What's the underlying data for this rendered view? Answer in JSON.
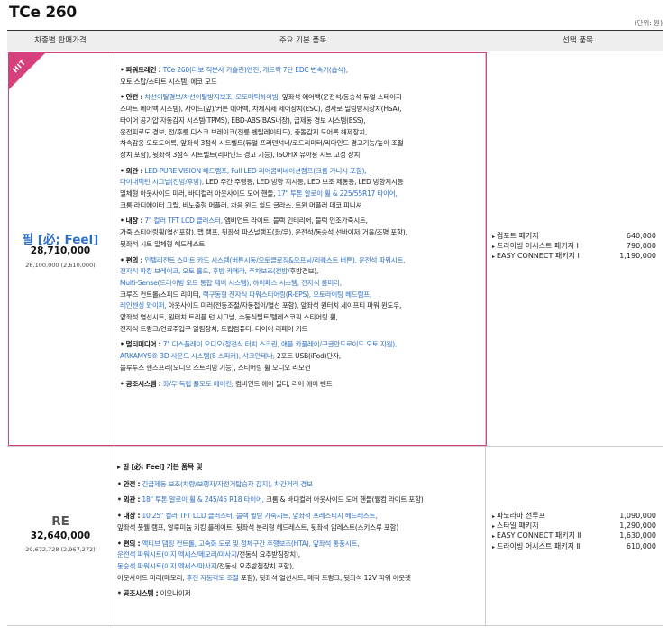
{
  "title": "TCe 260",
  "unit": "(단위: 원)",
  "headers": [
    "차종별 판매가격",
    "주요 기본 품목",
    "선택 품목"
  ],
  "hit_badge": "HIT",
  "trims": [
    {
      "name": "필 [必; Feel]",
      "price": "28,710,000",
      "sub_price": "26,100,000 (2,610,000)",
      "name_color": "#2c6fc5",
      "specs": [
        {
          "label": "파워트레인 :",
          "segments": [
            {
              "t": "TCe 260(터보 직분사 가솔린)엔진, 게트락 7단 EDC 변속기(습식),",
              "blue": true
            },
            {
              "t": "\n오토 스탑/스타트 시스템, 에코 모드",
              "blue": false
            }
          ]
        },
        {
          "label": "안전 :",
          "segments": [
            {
              "t": "차선이탈경보/차선이탈방지보조, 오토매틱하이빔,",
              "blue": true
            },
            {
              "t": " 앞좌석 에어백(운전석/동승석 듀얼 스테이지\n스마트 에어백 시스템), 사이드(앞)/커튼 에어백, 차체자세 제어장치(ESC), 경사로 밀림방지장치(HSA),\n타이어 공기압 자동감지 시스템(TPMS), EBD-ABS(BAS내장), 급제동 경보 시스템(ESS),\n운전피로도 경보, 전/후륜 디스크 브레이크(전륜 벤틸레이티드), 충돌감지 도어록 해제장치,\n차속감응 오토도어록, 앞좌석 3점식 시트벨트(듀얼 프리텐셔너/로드리미터/리마인드 경고기능/높이 조절\n장치 포함), 뒷좌석 3점식 시트벨트(리마인드 경고 기능), ISOFIX 유아용 시트 고정 장치",
              "blue": false
            }
          ]
        },
        {
          "label": "외관 :",
          "segments": [
            {
              "t": "LED PURE VISION 헤드램프, Full LED 리어콤비네이션램프(크롬 가니시 포함),\n다이내믹턴 시그널(전방/후방),",
              "blue": true
            },
            {
              "t": " LED 주간 주행등, LED 방향 지시등, LED 보조 제동등, LED 방향지시등\n일체형 아웃사이드 미러, 바디컬러 아웃사이드 도어 핸들,",
              "blue": false
            },
            {
              "t": " 17\" 투톤 알로이 휠 & 225/55R17 타이어,",
              "blue": true
            },
            {
              "t": "\n크롬 라디에이터 그릴, 비노출형 머플러, 차음 윈드 쉴드 글라스, 트윈 머플러 데코 피니셔",
              "blue": false
            }
          ]
        },
        {
          "label": "내장 :",
          "segments": [
            {
              "t": "7\" 컬러 TFT LCD 클러스터,",
              "blue": true
            },
            {
              "t": " 앰비언트 라이트, 블랙 인테리어, 블랙 인조가죽시트,\n가죽 스티어링휠(열선포함), 맵 램프, 뒷좌석 파스널램프(좌/우), 운전석/동승석 선바이저(거울/조명 포함),\n뒷좌석 시트 일체형 헤드레스트",
              "blue": false
            }
          ]
        },
        {
          "label": "편의 :",
          "segments": [
            {
              "t": "인텔리전트 스마트 카드 시스템(버튼시동/오토클로징&오프닝/리퀘스트 버튼), 운전석 파워시트,\n전자식 파킹 브레이크, 오토 홀드, 후방 카메라, 주차보조(전방/",
              "blue": true
            },
            {
              "t": "후방경보),",
              "blue": false
            },
            {
              "t": "\nMulti-Sense(드라이빙 모드 통합 제어 시스템), 하이패스 시스템, 전자식 룸미러,",
              "blue": true
            },
            {
              "t": "\n크루즈 컨트롤/스피드 리미터,",
              "blue": false
            },
            {
              "t": " 랙구동형 전자식 파워스티어링(R-EPS), 오토라이팅 헤드램프,\n레인센싱 와이퍼,",
              "blue": true
            },
            {
              "t": " 아웃사이드 미러(전동조절/자동접이/열선 포함), 앞좌석 원터치 세이프티 파워 윈도우,\n앞좌석 열선시트, 원터치 트리플 턴 시그널, 수동식틸트/텔레스코픽 스티어링 휠,\n전자식 트렁크/연료주입구 열림장치, 트립컴퓨터, 타이어 리페어 키트",
              "blue": false
            }
          ]
        },
        {
          "label": "멀티미디어 :",
          "segments": [
            {
              "t": "7\" 디스플레이 오디오(정전식 터치 스크린, 애플 카플레이/구글안드로이드 오토 지원),\nARKAMYS® 3D 사운드 시스템(8 스피커), 샤크안테나,",
              "blue": true
            },
            {
              "t": " 2포트 USB(iPod)단자,\n블루투스 핸즈프리(오디오 스트리밍 기능), 스티어링 휠 오디오 리모컨",
              "blue": false
            }
          ]
        },
        {
          "label": "공조시스템 :",
          "segments": [
            {
              "t": "좌/우 독립 풀오토 에어컨,",
              "blue": true
            },
            {
              "t": " 컴바인드 에어 필터, 리어 에어 벤트",
              "blue": false
            }
          ]
        }
      ],
      "options": [
        {
          "name": "컴포트 패키지",
          "price": "640,000"
        },
        {
          "name": "드라이빙 어시스트 패키지 Ⅰ",
          "price": "790,000"
        },
        {
          "name": "EASY CONNECT 패키지 Ⅰ",
          "price": "1,190,000"
        }
      ]
    },
    {
      "name": "RE",
      "price": "32,640,000",
      "sub_price": "29,672,728 (2,967,272)",
      "name_color": "#555555",
      "intro": "▸ 필 [必; Feel] 기본 품목 및",
      "specs": [
        {
          "label": "안전 :",
          "segments": [
            {
              "t": "긴급제동 보조(차량/보행자/자전거탑승자 감지), 차간거리 경보",
              "blue": true
            }
          ]
        },
        {
          "label": "외관 :",
          "segments": [
            {
              "t": "18\" 투톤 알로이 휠 & 245/45 R18 타이어,",
              "blue": true
            },
            {
              "t": " 크롬 & 바디컬러 아웃사이드 도어 핸들(웰컴 라이트 포함)",
              "blue": false
            }
          ]
        },
        {
          "label": "내장 :",
          "segments": [
            {
              "t": "10.25\" 컬러 TFT LCD 클러스터, 블랙 퀼팅 가죽시트, 앞좌석 프레스티지 헤드레스트,",
              "blue": true
            },
            {
              "t": "\n앞좌석 풋웰 램프, 알루미늄 키킹 플레이트, 뒷좌석 분리형 헤드레스트, 뒷좌석 암레스트(스키스루 포함)",
              "blue": false
            }
          ]
        },
        {
          "label": "편의 :",
          "segments": [
            {
              "t": "액티브 댐핑 컨트롤, 고속화 도로 및 정체구간 주행보조(HTA), 앞좌석 통풍시트,\n운전석 파워시트(이지 엑세스/메모리/마사지",
              "blue": true
            },
            {
              "t": "/전동식 요추받침장치),",
              "blue": false
            },
            {
              "t": "\n동승석 파워시트(이지 엑세스/마사지",
              "blue": true
            },
            {
              "t": "/전동식 요추받침장치 포함),\n아웃사이드 미러(메모리,",
              "blue": false
            },
            {
              "t": " 후진 자동각도 조절",
              "blue": true
            },
            {
              "t": " 포함), 뒷좌석 열선시트, 매직 트렁크, 뒷좌석 12V 파워 아웃렛",
              "blue": false
            }
          ]
        },
        {
          "label": "공조시스템 :",
          "segments": [
            {
              "t": " 이오나이저",
              "blue": false
            }
          ]
        }
      ],
      "options": [
        {
          "name": "파노라마 선루프",
          "price": "1,090,000"
        },
        {
          "name": "스타일 패키지",
          "price": "1,290,000"
        },
        {
          "name": "EASY CONNECT 패키지 Ⅱ",
          "price": "1,630,000"
        },
        {
          "name": "드라이빙 어시스트 패키지 Ⅱ",
          "price": "610,000"
        }
      ]
    }
  ]
}
